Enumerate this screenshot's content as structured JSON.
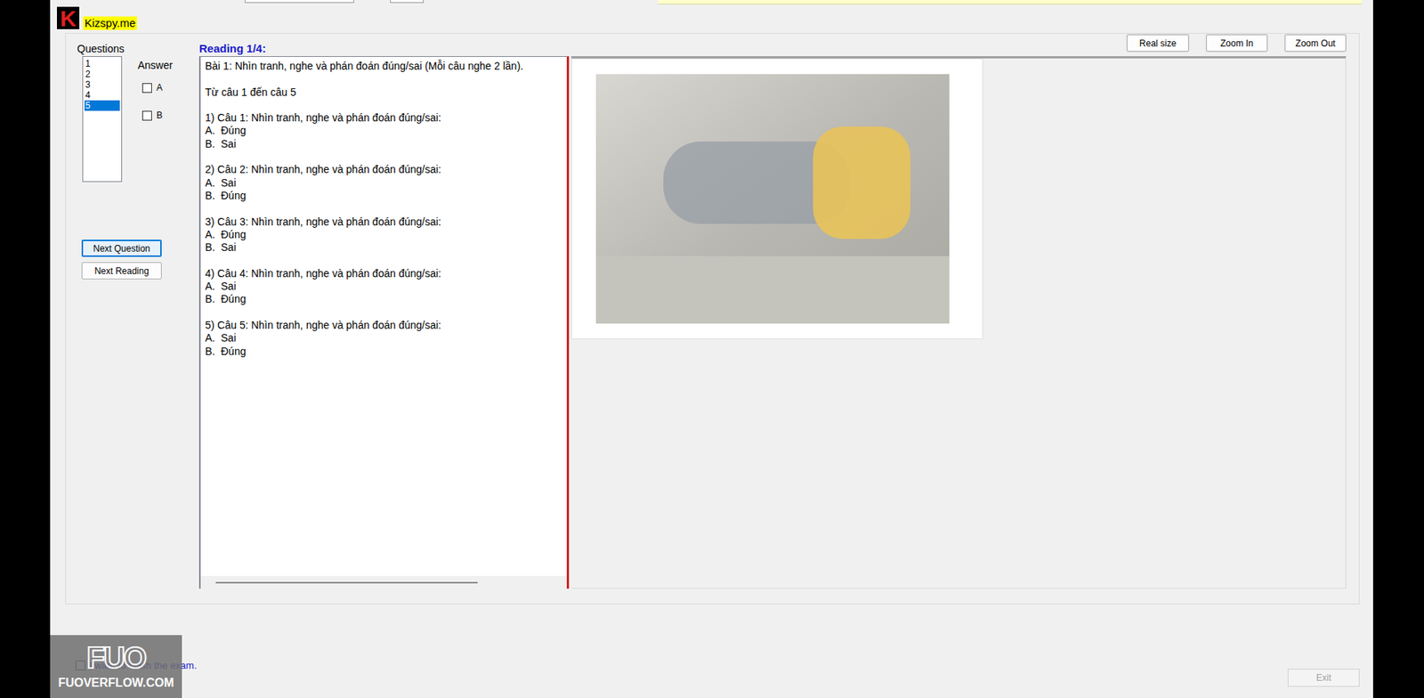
{
  "watermark_top": {
    "logo_letter": "K",
    "text": "Kizspy.me"
  },
  "questions_panel": {
    "label": "Questions",
    "items": [
      {
        "label": "1",
        "selected": false
      },
      {
        "label": "2",
        "selected": false
      },
      {
        "label": "3",
        "selected": false
      },
      {
        "label": "4",
        "selected": false
      },
      {
        "label": "5",
        "selected": true
      }
    ]
  },
  "answer_panel": {
    "label": "Answer",
    "options": [
      {
        "label": "A",
        "checked": false
      },
      {
        "label": "B",
        "checked": false
      }
    ]
  },
  "nav_buttons": [
    "Next Question",
    "Next Reading"
  ],
  "reading": {
    "title": "Reading 1/4:",
    "intro": "Bài 1: Nhìn tranh, nghe và phán đoán đúng/sai (Mỗi câu nghe 2 lần).",
    "range": "Từ câu 1 đến câu 5",
    "questions": [
      {
        "title": "1) Câu 1: Nhìn tranh, nghe và phán đoán đúng/sai:",
        "options": [
          "A.  Đúng",
          "B.  Sai"
        ]
      },
      {
        "title": "2) Câu 2: Nhìn tranh, nghe và phán đoán đúng/sai:",
        "options": [
          "A.  Sai",
          "B.  Đúng"
        ]
      },
      {
        "title": "3) Câu 3: Nhìn tranh, nghe và phán đoán đúng/sai:",
        "options": [
          "A.  Đúng",
          "B.  Sai"
        ]
      },
      {
        "title": "4) Câu 4: Nhìn tranh, nghe và phán đoán đúng/sai:",
        "options": [
          "A.  Sai",
          "B.  Đúng"
        ]
      },
      {
        "title": "5) Câu 5: Nhìn tranh, nghe và phán đoán đúng/sai:",
        "options": [
          "A.  Sai",
          "B.  Đúng"
        ]
      }
    ]
  },
  "image_buttons": [
    "Real size",
    "Zoom In",
    "Zoom Out"
  ],
  "finish": {
    "label": "I want to finish the exam.",
    "checked": false
  },
  "exit_button": {
    "label": "Exit",
    "disabled": true
  },
  "watermark_bottom": {
    "logo": "FUO",
    "text": "FUOVERFLOW.COM"
  }
}
